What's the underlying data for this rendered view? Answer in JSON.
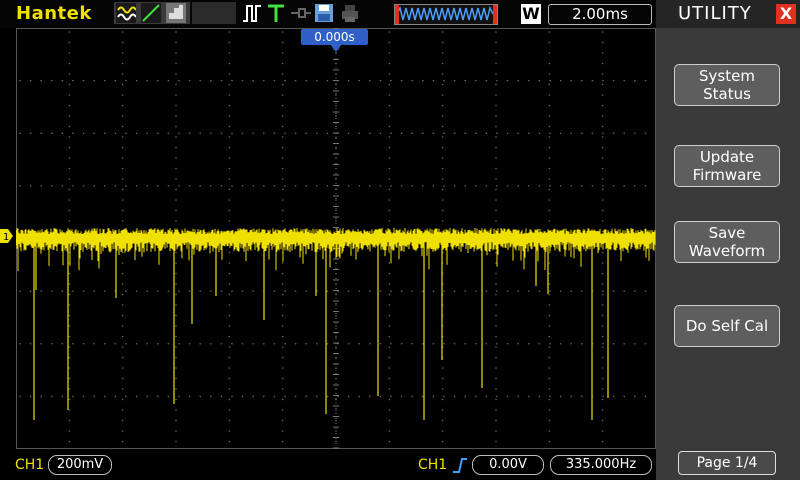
{
  "header": {
    "brand": "Hantek",
    "timebase": "2.00ms",
    "trigger_position": "0.000s",
    "icons": [
      "ac-wave-icon",
      "ramp-icon",
      "acquire-mode-icon",
      "pulse-icon",
      "trigger-t-icon",
      "save-disk-icon",
      "printer-icon",
      "waveform-memory-icon",
      "w-zoom-icon"
    ]
  },
  "bottom": {
    "ch1_label": "CH1",
    "ch1_scale": "200mV",
    "trig_source": "CH1",
    "trig_level": "0.00V",
    "frequency": "335.000Hz"
  },
  "menu": {
    "title": "UTILITY",
    "items": [
      {
        "label": "System\nStatus"
      },
      {
        "label": "Update\nFirmware"
      },
      {
        "label": "Save\nWaveform"
      },
      {
        "label": "Do Self Cal"
      }
    ],
    "page": "Page 1/4"
  },
  "colors": {
    "trace": "#f0e000",
    "menu_bg": "#3a3a3a",
    "trigger_marker": "#2f5fc8",
    "close": "#e03020"
  }
}
